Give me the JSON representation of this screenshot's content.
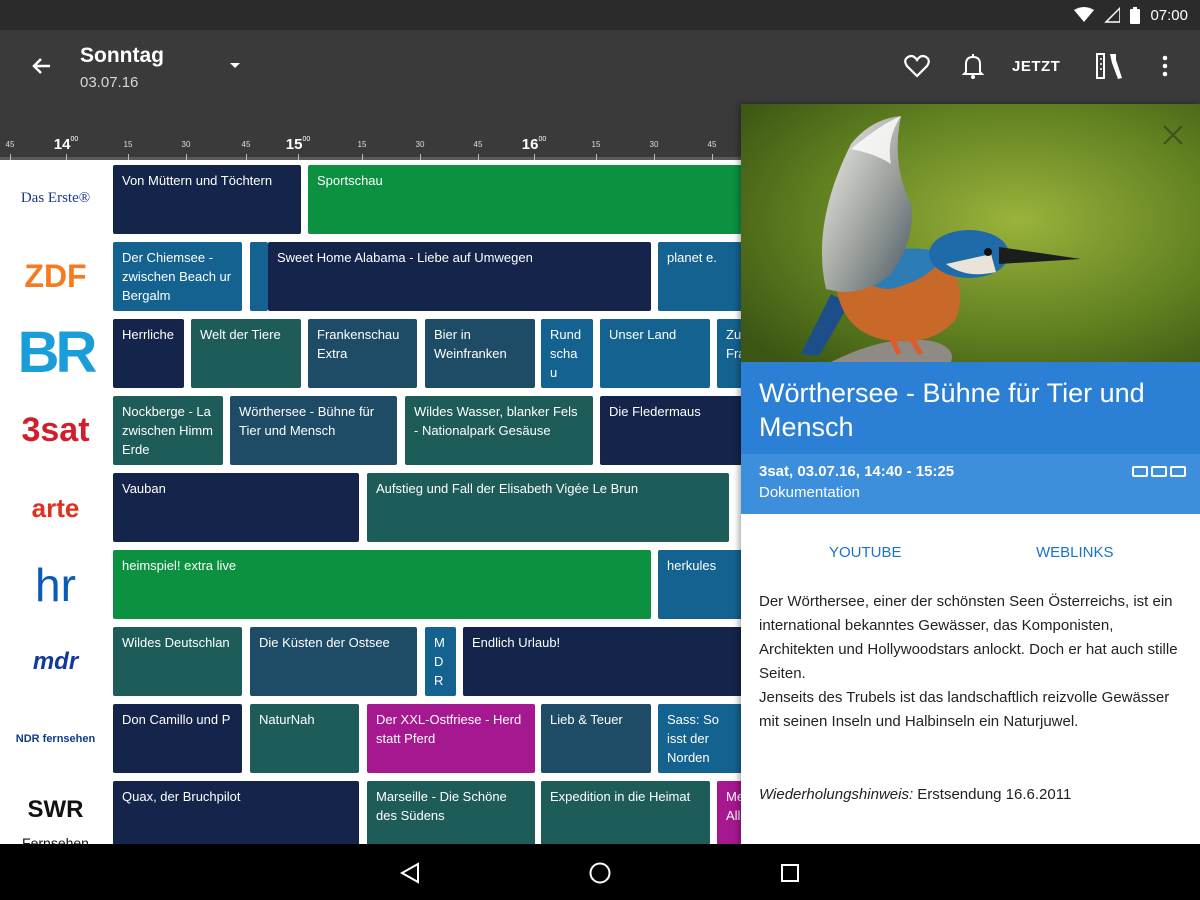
{
  "status": {
    "time": "07:00"
  },
  "toolbar": {
    "title": "Sonntag",
    "subtitle": "03.07.16",
    "now_label": "JETZT"
  },
  "ruler": {
    "ticks": [
      "45",
      "14",
      "15",
      "30",
      "45",
      "15",
      "15",
      "30",
      "45",
      "16",
      "15",
      "30",
      "45"
    ],
    "major_sup": "00"
  },
  "channels": [
    {
      "name": "Das Erste",
      "logo_text": "Das Erste®",
      "color": "#1a3a8f"
    },
    {
      "name": "ZDF",
      "logo_text": "ZDF",
      "color": "#f47b20"
    },
    {
      "name": "BR",
      "logo_text": "BR",
      "color": "#1a9ed9"
    },
    {
      "name": "3sat",
      "logo_text": "3sat",
      "color": "#d21e2b"
    },
    {
      "name": "arte",
      "logo_text": "arte",
      "color": "#e0301e"
    },
    {
      "name": "hr",
      "logo_text": "hr",
      "color": "#0a5bb5"
    },
    {
      "name": "mdr",
      "logo_text": "mdr",
      "color": "#123a9c"
    },
    {
      "name": "NDR",
      "logo_text": "NDR fernsehen",
      "color": "#0b3c8c"
    },
    {
      "name": "SWR",
      "logo_text": "SWR",
      "sub": "Fernsehen",
      "color": "#111111"
    }
  ],
  "programs": [
    [
      {
        "t": "Von Müttern und Töchtern",
        "c": "navy"
      },
      {
        "t": "Sportschau",
        "c": "green"
      }
    ],
    [
      {
        "t": "Der Chiemsee - zwischen Beach ur Bergalm",
        "c": "blue"
      },
      {
        "t": "",
        "c": "blue"
      },
      {
        "t": "Sweet Home Alabama - Liebe auf Umwegen",
        "c": "navy"
      },
      {
        "t": "planet e.",
        "c": "blue"
      }
    ],
    [
      {
        "t": "Herrliche",
        "c": "navy"
      },
      {
        "t": "Welt der Tiere",
        "c": "teal"
      },
      {
        "t": "Frankenschau Extra",
        "c": "slate"
      },
      {
        "t": "Bier in Weinfranken",
        "c": "slate"
      },
      {
        "t": "Rund scha u",
        "c": "blue"
      },
      {
        "t": "Unser Land",
        "c": "blue"
      },
      {
        "t": "Zu Fra",
        "c": "blue"
      }
    ],
    [
      {
        "t": "Nockberge - La zwischen Himm Erde",
        "c": "teal"
      },
      {
        "t": "Wörthersee - Bühne für Tier und Mensch",
        "c": "slate"
      },
      {
        "t": "Wildes Wasser, blanker Fels - Nationalpark Gesäuse",
        "c": "teal"
      },
      {
        "t": "Die Fledermaus",
        "c": "navy"
      }
    ],
    [
      {
        "t": "Vauban",
        "c": "navy"
      },
      {
        "t": "Aufstieg und Fall der Elisabeth Vigée Le Brun",
        "c": "teal"
      }
    ],
    [
      {
        "t": "heimspiel! extra live",
        "c": "green"
      },
      {
        "t": "herkules",
        "c": "blue"
      }
    ],
    [
      {
        "t": "Wildes Deutschlan",
        "c": "teal"
      },
      {
        "t": "Die Küsten der Ostsee",
        "c": "slate"
      },
      {
        "t": "M D R",
        "c": "blue"
      },
      {
        "t": "Endlich Urlaub!",
        "c": "navy"
      }
    ],
    [
      {
        "t": "Don Camillo und P",
        "c": "navy"
      },
      {
        "t": "NaturNah",
        "c": "teal"
      },
      {
        "t": "Der XXL-Ostfriese - Herd statt Pferd",
        "c": "magenta"
      },
      {
        "t": "Lieb & Teuer",
        "c": "slate"
      },
      {
        "t": "Sass: So isst der Norden",
        "c": "blue"
      }
    ],
    [
      {
        "t": "Quax, der Bruchpilot",
        "c": "navy"
      },
      {
        "t": "Marseille - Die Schöne des Südens",
        "c": "teal"
      },
      {
        "t": "Expedition in die Heimat",
        "c": "teal"
      },
      {
        "t": "Me All",
        "c": "magenta"
      }
    ]
  ],
  "colors": {
    "navy": "#15244a",
    "green": "#0c9141",
    "blue": "#14628f",
    "teal": "#1e5c5a",
    "slate": "#1e4b66",
    "magenta": "#a6188f",
    "accent": "#2b7fd4"
  },
  "detail": {
    "title": "Wörthersee - Bühne für Tier und Mensch",
    "meta": "3sat, 03.07.16, 14:40 - 15:25",
    "genre": "Dokumentation",
    "actions": [
      "YOUTUBE",
      "WEBLINKS"
    ],
    "description": "Der Wörthersee, einer der schönsten Seen Österreichs, ist ein international bekanntes Gewässer, das Komponisten, Architekten und Hollywoodstars anlockt. Doch er hat auch stille Seiten.",
    "description2": "Jenseits des Trubels ist das landschaftlich reizvolle Gewässer mit seinen Inseln und Halbinseln ein Naturjuwel.",
    "repeat_label": "Wiederholungshinweis:",
    "repeat_value": "Erstsendung 16.6.2011"
  }
}
